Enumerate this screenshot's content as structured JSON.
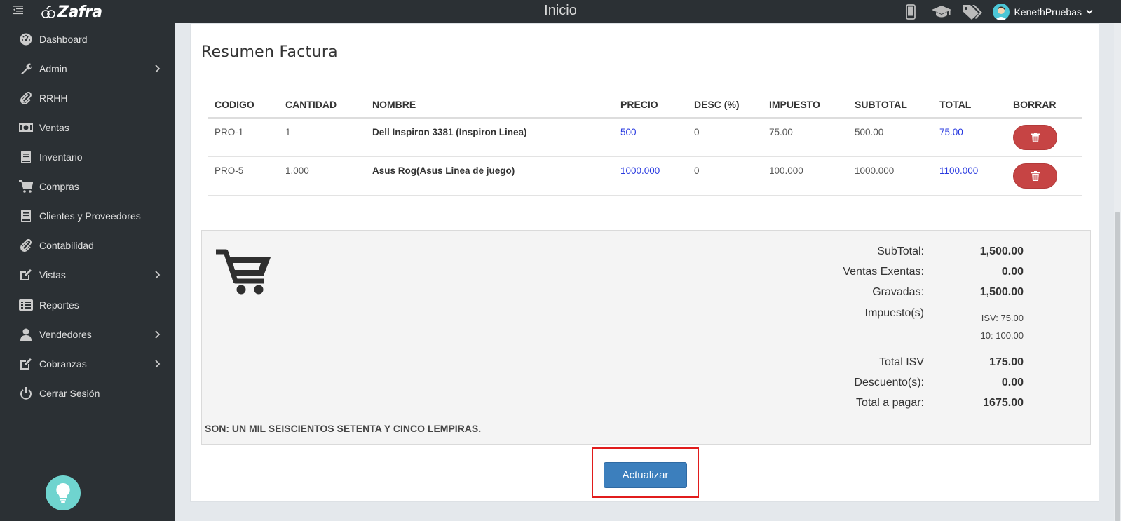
{
  "header": {
    "logo_text": "Zafra",
    "page_title": "Inicio",
    "user_name": "KenethPruebas"
  },
  "sidebar": {
    "items": [
      {
        "label": "Dashboard",
        "icon": "dashboard-icon",
        "has_submenu": false
      },
      {
        "label": "Admin",
        "icon": "wrench-icon",
        "has_submenu": true
      },
      {
        "label": "RRHH",
        "icon": "paperclip-icon",
        "has_submenu": false
      },
      {
        "label": "Ventas",
        "icon": "money-icon",
        "has_submenu": false
      },
      {
        "label": "Inventario",
        "icon": "book-icon",
        "has_submenu": false
      },
      {
        "label": "Compras",
        "icon": "cart-icon",
        "has_submenu": false
      },
      {
        "label": "Clientes y Proveedores",
        "icon": "book-icon",
        "has_submenu": false
      },
      {
        "label": "Contabilidad",
        "icon": "paperclip-icon",
        "has_submenu": false
      },
      {
        "label": "Vistas",
        "icon": "edit-icon",
        "has_submenu": true
      },
      {
        "label": "Reportes",
        "icon": "list-icon",
        "has_submenu": false
      },
      {
        "label": "Vendedores",
        "icon": "user-icon",
        "has_submenu": true
      },
      {
        "label": "Cobranzas",
        "icon": "edit-icon",
        "has_submenu": true
      },
      {
        "label": "Cerrar Sesión",
        "icon": "power-icon",
        "has_submenu": false
      }
    ]
  },
  "invoice": {
    "title": "Resumen Factura",
    "columns": [
      "CODIGO",
      "CANTIDAD",
      "NOMBRE",
      "PRECIO",
      "DESC (%)",
      "IMPUESTO",
      "SUBTOTAL",
      "TOTAL",
      "BORRAR"
    ],
    "rows": [
      {
        "codigo": "PRO-1",
        "cantidad": "1",
        "nombre": "Dell Inspiron 3381 (Inspiron Linea)",
        "precio": "500",
        "desc": "0",
        "impuesto": "75.00",
        "subtotal": "500.00",
        "total": "75.00"
      },
      {
        "codigo": "PRO-5",
        "cantidad": "1.000",
        "nombre": "Asus Rog(Asus Linea de juego)",
        "precio": "1000.000",
        "desc": "0",
        "impuesto": "100.000",
        "subtotal": "1000.000",
        "total": "1100.000"
      }
    ]
  },
  "summary": {
    "subtotal_label": "SubTotal:",
    "subtotal_value": "1,500.00",
    "exentas_label": "Ventas Exentas:",
    "exentas_value": "0.00",
    "gravadas_label": "Gravadas:",
    "gravadas_value": "1,500.00",
    "impuestos_label": "Impuesto(s)",
    "impuesto_isv": "ISV: 75.00",
    "impuesto_10": "10: 100.00",
    "total_isv_label": "Total ISV",
    "total_isv_value": "175.00",
    "descuentos_label": "Descuento(s):",
    "descuentos_value": "0.00",
    "total_pagar_label": "Total a pagar:",
    "total_pagar_value": "1675.00",
    "amount_in_words": "SON: UN MIL SEISCIENTOS SETENTA Y CINCO LEMPIRAS."
  },
  "actions": {
    "update_label": "Actualizar"
  },
  "colors": {
    "sidebar_bg": "#2b3034",
    "link_blue": "#2a3be0",
    "delete_red": "#c64444",
    "primary_blue": "#3c7fbd",
    "highlight_red": "#e11c1c"
  }
}
